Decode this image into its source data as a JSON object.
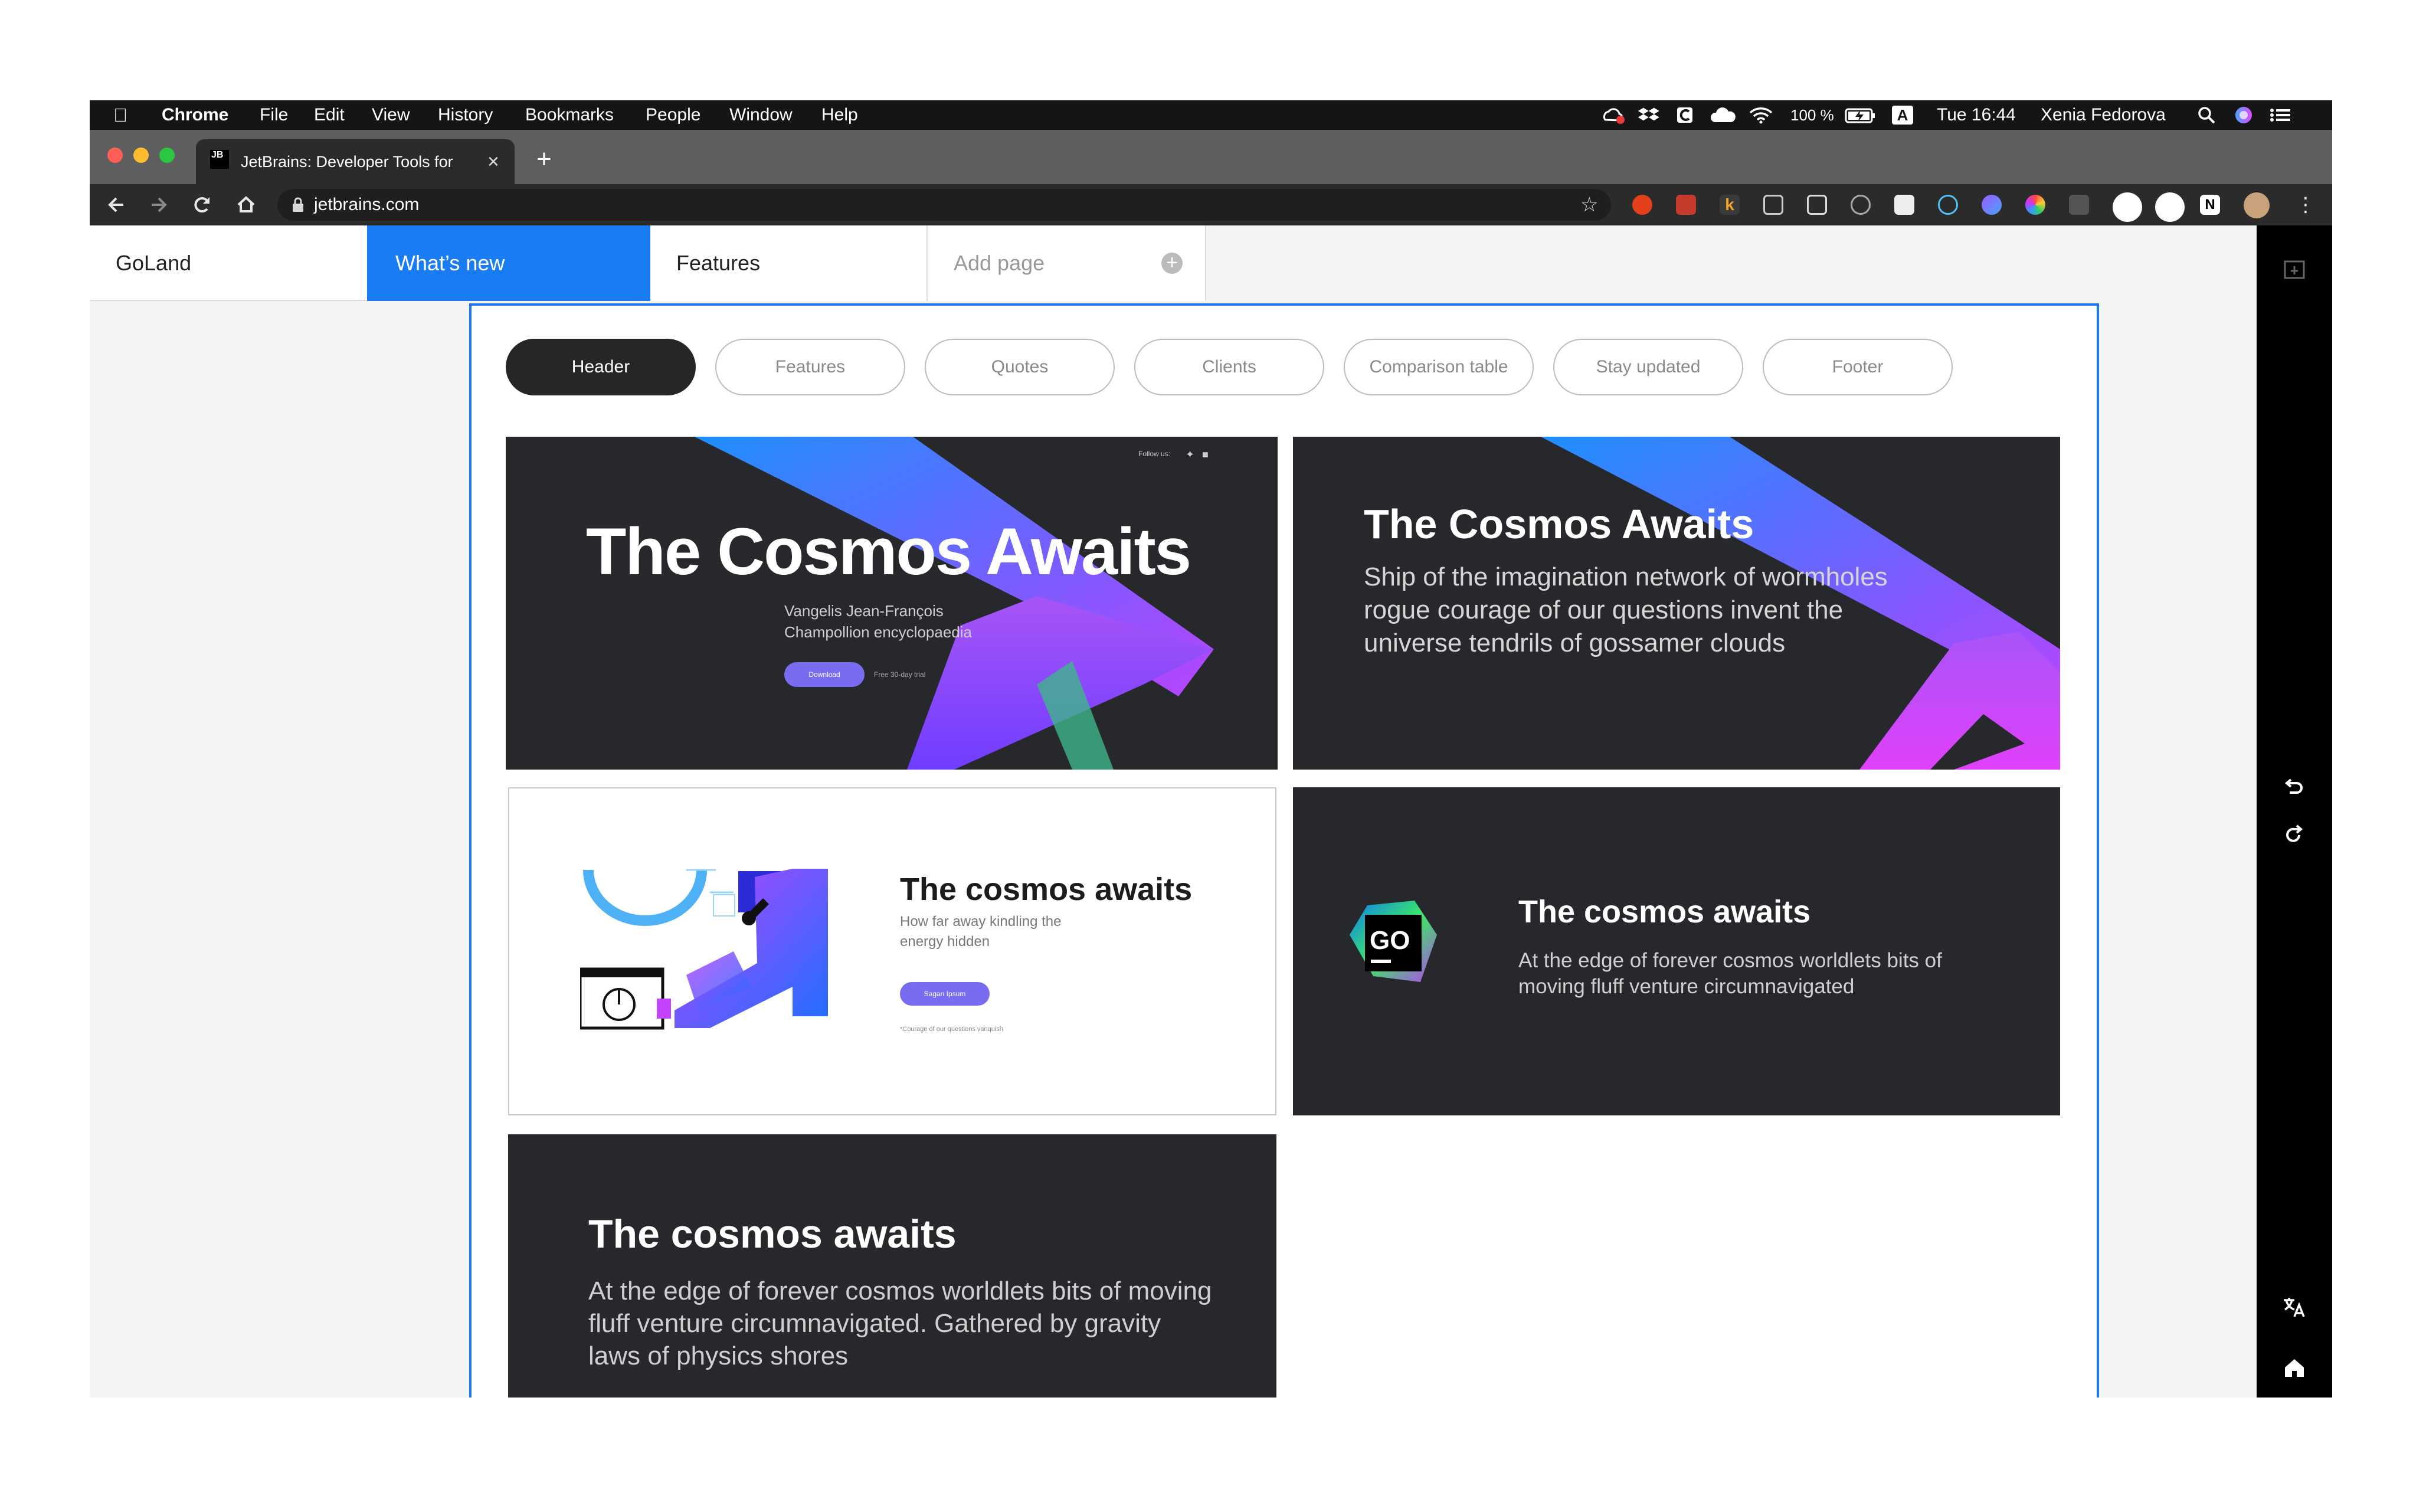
{
  "menubar": {
    "app": "Chrome",
    "items": [
      "File",
      "Edit",
      "View",
      "History",
      "Bookmarks",
      "People",
      "Window",
      "Help"
    ],
    "battery": "100 %",
    "input_source": "A",
    "clock": "Tue 16:44",
    "user": "Xenia Fedorova"
  },
  "browser": {
    "tab_favicon": "JB",
    "tab_title": "JetBrains: Developer Tools for",
    "url": "jetbrains.com"
  },
  "app": {
    "page_tabs": [
      {
        "label": "GoLand"
      },
      {
        "label": "What’s new"
      },
      {
        "label": "Features"
      }
    ],
    "add_page_label": "Add page",
    "sections": [
      "Header",
      "Features",
      "Quotes",
      "Clients",
      "Comparison table",
      "Stay updated",
      "Footer"
    ],
    "cards": {
      "c1": {
        "follow": "Follow us:",
        "title": "The Cosmos Awaits",
        "subtitle_line1": "Vangelis Jean-François",
        "subtitle_line2": "Champollion encyclopaedia",
        "button": "Download",
        "trial": "Free 30-day trial"
      },
      "c2": {
        "title": "The Cosmos Awaits",
        "text": "Ship of the imagination network of wormholes rogue courage of our questions invent the universe tendrils of gossamer clouds"
      },
      "c3": {
        "title": "The cosmos awaits",
        "text_line1": "How far away kindling the",
        "text_line2": "energy hidden",
        "button": "Sagan Ipsum",
        "note": "*Courage of our questions vanquish"
      },
      "c4": {
        "logo": "GO",
        "title": "The cosmos awaits",
        "text": "At the edge of forever cosmos worldlets bits of moving fluff venture circumnavigated"
      },
      "c5": {
        "title": "The cosmos awaits",
        "text": "At the edge of forever cosmos worldlets bits of moving fluff venture circumnavigated. Gathered by gravity laws of physics shores"
      }
    }
  },
  "colors": {
    "accent": "#1a7cf2",
    "dark_card": "#27282c",
    "purple_button": "#7a6cf0",
    "gradient_blue": "#1f8fff",
    "gradient_purple": "#b844ff"
  },
  "icons": {
    "menubar": [
      "apple-icon"
    ],
    "tray": [
      "creative-cloud-icon",
      "dropbox-icon",
      "c-app-icon",
      "cloud-icon",
      "wifi-icon",
      "battery-icon",
      "spotlight-icon",
      "siri-icon",
      "notification-center-icon"
    ],
    "toolbar": [
      "back-icon",
      "forward-icon",
      "reload-icon",
      "home-icon",
      "lock-icon",
      "star-icon",
      "extension-icons",
      "profile-icon",
      "more-icon"
    ],
    "app": [
      "add-page-icon",
      "panel-icon",
      "undo-icon",
      "redo-icon",
      "translate-icon",
      "home-icon"
    ]
  }
}
